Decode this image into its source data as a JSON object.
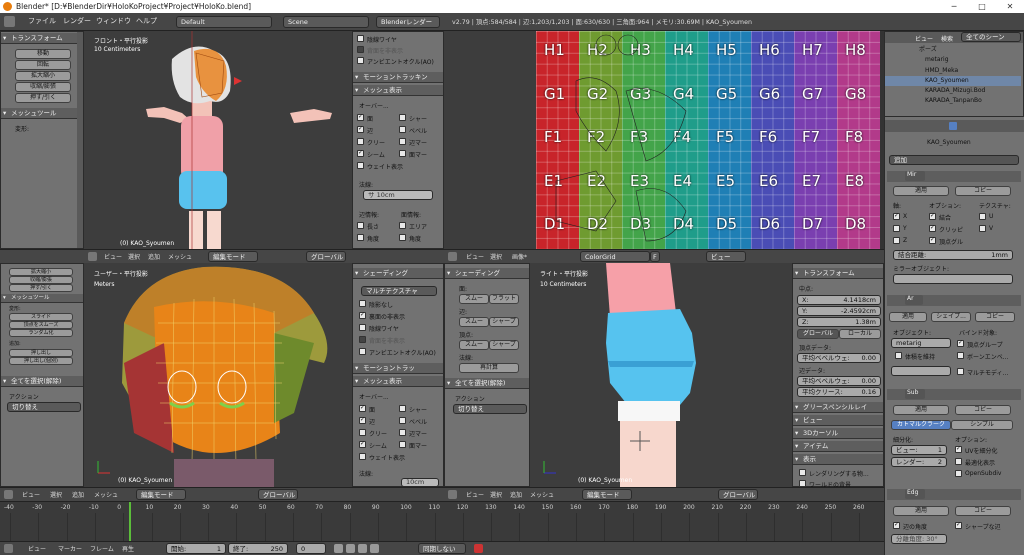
{
  "window": {
    "title": "Blender* [D:¥BlenderDir¥HoloKoProject¥Project¥HoloKo.blend]",
    "minimize": "─",
    "maximize": "□",
    "close": "✕"
  },
  "menu": [
    "ファイル",
    "レンダー",
    "ウィンドウ",
    "ヘルプ"
  ],
  "layout": "Default",
  "scene": "Scene",
  "engine": "Blenderレンダー",
  "stats": "v2.79 | 頂点:584/584 | 辺:1,203/1,203 | 面:630/630 | 三角面:964 | メモリ:30.69M | KAO_Syoumen",
  "tools_top": {
    "transform": "トランスフォーム",
    "buttons": [
      "移動",
      "回転",
      "拡大縮小",
      "収縮/膨張",
      "押す/引く"
    ],
    "mesh_tools": "メッシュツール",
    "deform": "変形:"
  },
  "vp_tl": {
    "view": "フロント・平行投影",
    "scale": "10 Centimeters",
    "object": "(0) KAO_Syoumen"
  },
  "prop_tl": {
    "wire": "陰線ワイヤ",
    "backface": "背面を非表示",
    "ao": "アンビエントオクル(AO)",
    "motion": "モーショントラッキン",
    "mesh_display": "メッシュ表示",
    "overlay": "オーバー...",
    "items": [
      "面",
      "辺",
      "クリー",
      "シーム",
      "シャー",
      "ベベル",
      "辺マー",
      "面マー"
    ],
    "weight": "ウェイト表示",
    "normal": "法線:",
    "size": "サ 10cm",
    "edge_info": "辺情報:",
    "face_info": "面情報:",
    "len": "長さ",
    "area": "エリア",
    "angle": "角度",
    "angle2": "角度"
  },
  "uv": {
    "labels": [
      [
        "H1",
        "H2",
        "H3",
        "H4",
        "H5",
        "H6",
        "H7",
        "H8"
      ],
      [
        "G1",
        "G2",
        "G3",
        "G4",
        "G5",
        "G6",
        "G7",
        "G8"
      ],
      [
        "F1",
        "F2",
        "F3",
        "F4",
        "F5",
        "F6",
        "F7",
        "F8"
      ],
      [
        "E1",
        "E2",
        "E3",
        "E4",
        "E5",
        "E6",
        "E7",
        "E8"
      ],
      [
        "D1",
        "D2",
        "D3",
        "D4",
        "D5",
        "D6",
        "D7",
        "D8"
      ]
    ],
    "colors": [
      "#c8242a",
      "#6f9b30",
      "#43a44a",
      "#1f9d8a",
      "#1f7fb5",
      "#4a4db5",
      "#7a3fb0",
      "#b23a8a"
    ]
  },
  "outliner": {
    "header": [
      "ビュー",
      "検索",
      "全てのシーン"
    ],
    "rows": [
      "ポーズ",
      "metarig",
      "HMD_Meka",
      "KAO_Syoumen",
      "KARADA_Mizugi.Bod",
      "KARADA_TanpanBo"
    ]
  },
  "props_right": {
    "object": "KAO_Syoumen",
    "add": "追加",
    "mirror": {
      "tab": "Mir",
      "apply": "適用",
      "copy": "コピー",
      "axis": "軸:",
      "options": "オプション:",
      "texture": "テクスチャ:",
      "x": "X",
      "y": "Y",
      "z": "Z",
      "merge": "結合",
      "clip": "クリッピ",
      "vgroup": "頂点グル",
      "u": "U",
      "v": "V",
      "dist": "結合距離:",
      "dist_val": "1mm",
      "mirror_obj": "ミラーオブジェクト:"
    },
    "armature": {
      "tab": "Ar",
      "apply": "適用",
      "shape": "シェイプ...",
      "copy": "コピー",
      "object": "オブジェクト:",
      "obj_val": "metarig",
      "bind": "バインド対象:",
      "preserve": "体積を維持",
      "vgroups": "頂点グループ",
      "envelope": "ボーンエンベ...",
      "multi": "マルチモディ..."
    },
    "subsurf": {
      "tab": "Sub",
      "apply": "適用",
      "copy": "コピー",
      "catmull": "カトマルクラーク",
      "simple": "シンプル",
      "subdiv": "細分化:",
      "options": "オプション:",
      "view": "ビュー:",
      "view_val": "1",
      "render": "レンダー:",
      "render_val": "2",
      "uv": "UVを細分化",
      "opt": "最適化表示",
      "opensubdiv": "OpenSubdiv"
    },
    "edge": {
      "tab": "Edg",
      "apply": "適用",
      "copy": "コピー",
      "angle": "辺の角度",
      "sharp": "シャープな辺",
      "split_angle": "分離角度: 30°"
    }
  },
  "header_top": {
    "view": "ビュー",
    "select": "選択",
    "add": "追加",
    "mesh": "メッシュ",
    "mode": "編集モード",
    "global": "グローバル"
  },
  "header_uv": {
    "view": "ビュー",
    "select": "選択",
    "image": "画像*",
    "img_name": "ColorGrid",
    "f": "F",
    "view2": "ビュー"
  },
  "tools_bl": {
    "items": [
      "拡大縮小",
      "収縮/膨張",
      "押す/引く",
      "メッシュツール",
      "変形:",
      "スライド",
      "頂点をスムーズ",
      "ランダム化",
      "追加:",
      "押し出し",
      "押し出し(個別)",
      "全てを選択(解除)",
      "アクション",
      "切り替え"
    ]
  },
  "vp_bl": {
    "view": "ユーザー・平行投影",
    "scale": "Meters",
    "object": "(0) KAO_Syoumen"
  },
  "prop_bl": {
    "shading": "シェーディング",
    "matcap": "マルチテクスチャ",
    "items": [
      "陰影なし",
      "裏面の非表示",
      "陰線ワイヤ",
      "背面を非表示",
      "アンビエントオクル(AO)"
    ],
    "motion": "モーショントラッ",
    "mesh": "メッシュ表示",
    "overlay": "オーバー...",
    "checks": [
      "面",
      "辺",
      "クリー",
      "シーム",
      "シャー",
      "ベベル",
      "辺マー",
      "面マー"
    ],
    "weight": "ウェイト表示",
    "normal": "法線:",
    "size": "10cm"
  },
  "tools_bm": {
    "shading": "シェーディング",
    "face": "面:",
    "smooth": "スムー",
    "flat": "フラット",
    "edge": "辺:",
    "smooth2": "スムー",
    "sharp": "シャープ",
    "vert": "頂点:",
    "smooth3": "スムー",
    "sharp2": "シャープ",
    "normal": "法線:",
    "recalc": "再計算",
    "select": "全てを選択(解除)",
    "action": "アクション",
    "toggle": "切り替え"
  },
  "vp_br": {
    "view": "ライト・平行投影",
    "scale": "10 Centimeters",
    "object": "(0) KAO_Syoumen"
  },
  "prop_br": {
    "transform": "トランスフォーム",
    "center": "中点:",
    "x": "X:",
    "xv": "4.1418cm",
    "y": "Y:",
    "yv": "-2.4592cm",
    "z": "Z:",
    "zv": "1.38m",
    "global": "グローバル",
    "local": "ローカル",
    "vdata": "頂点データ:",
    "bevel": "平均ベベルウェ:",
    "bevel_v": "0.00",
    "edata": "辺データ:",
    "ebevel": "平均ベベルウェ:",
    "ebevel_v": "0.00",
    "crease": "平均クリース:",
    "crease_v": "0.16",
    "grease": "グリースペンシルレイ",
    "view": "ビュー",
    "cursor": "3Dカーソル",
    "item": "アイテム",
    "display": "表示",
    "rendered": "レンダリングする物...",
    "world": "ワールドの背景"
  },
  "timeline": {
    "ticks": [
      "-40",
      "-30",
      "-20",
      "-10",
      "0",
      "10",
      "20",
      "30",
      "40",
      "50",
      "60",
      "70",
      "80",
      "90",
      "100",
      "110",
      "120",
      "130",
      "140",
      "150",
      "160",
      "170",
      "180",
      "190",
      "200",
      "210",
      "220",
      "230",
      "240",
      "250",
      "260"
    ],
    "bar": [
      "ビュー",
      "マーカー",
      "フレーム",
      "再生"
    ],
    "start": "開始:",
    "start_v": "1",
    "end": "終了:",
    "end_v": "250",
    "frame": "0",
    "sync": "同期しない"
  }
}
